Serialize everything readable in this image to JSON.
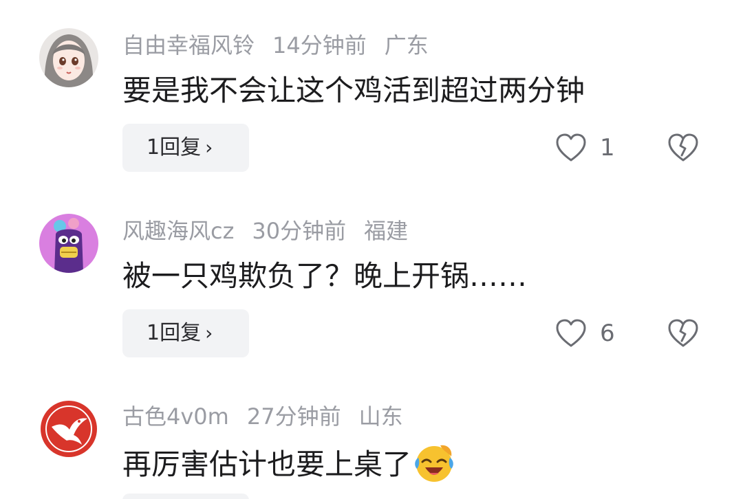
{
  "comments": [
    {
      "username": "自由幸福风铃",
      "time": "14分钟前",
      "location": "广东",
      "text": "要是我不会让这个鸡活到超过两分钟",
      "reply_label": "1回复",
      "reply_chevron": "›",
      "like_count": "1",
      "avatar_icon": "anime-girl-avatar"
    },
    {
      "username": "风趣海风cz",
      "time": "30分钟前",
      "location": "福建",
      "text": "被一只鸡欺负了？晚上开锅……",
      "reply_label": "1回复",
      "reply_chevron": "›",
      "like_count": "6",
      "avatar_icon": "purple-cartoon-avatar"
    },
    {
      "username": "古色4v0m",
      "time": "27分钟前",
      "location": "山东",
      "text": "再厉害估计也要上桌了",
      "emoji": "laughing-crying-emoji",
      "avatar_icon": "red-bird-logo-avatar"
    }
  ],
  "colors": {
    "meta": "#9a9ca3",
    "text": "#1c1c1e",
    "reply_bg": "#f2f3f5",
    "icon_stroke": "#6a6c72"
  }
}
